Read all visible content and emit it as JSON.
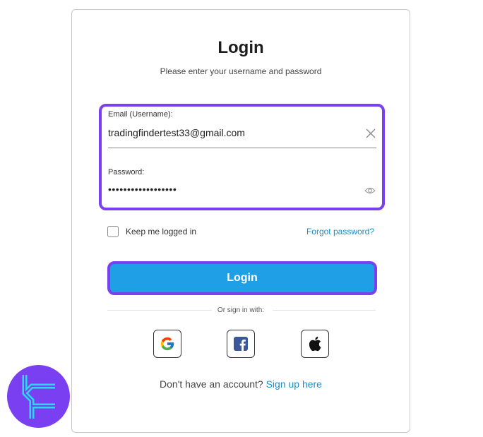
{
  "login": {
    "title": "Login",
    "subtitle": "Please enter your username and password",
    "email_label": "Email (Username):",
    "email_value": "tradingfindertest33@gmail.com",
    "password_label": "Password:",
    "password_value": "••••••••••••••••••",
    "remember_label": "Keep me logged in",
    "forgot_label": "Forgot password?",
    "login_button_label": "Login",
    "divider_text": "Or sign in with:",
    "signup_text": "Don't have an account?",
    "signup_link": "Sign up here"
  },
  "social": [
    "google-icon",
    "facebook-icon",
    "apple-icon"
  ],
  "colors": {
    "accent_border": "#7b3ff2",
    "login_button": "#1fa0e6",
    "link": "#1a8ec9"
  }
}
